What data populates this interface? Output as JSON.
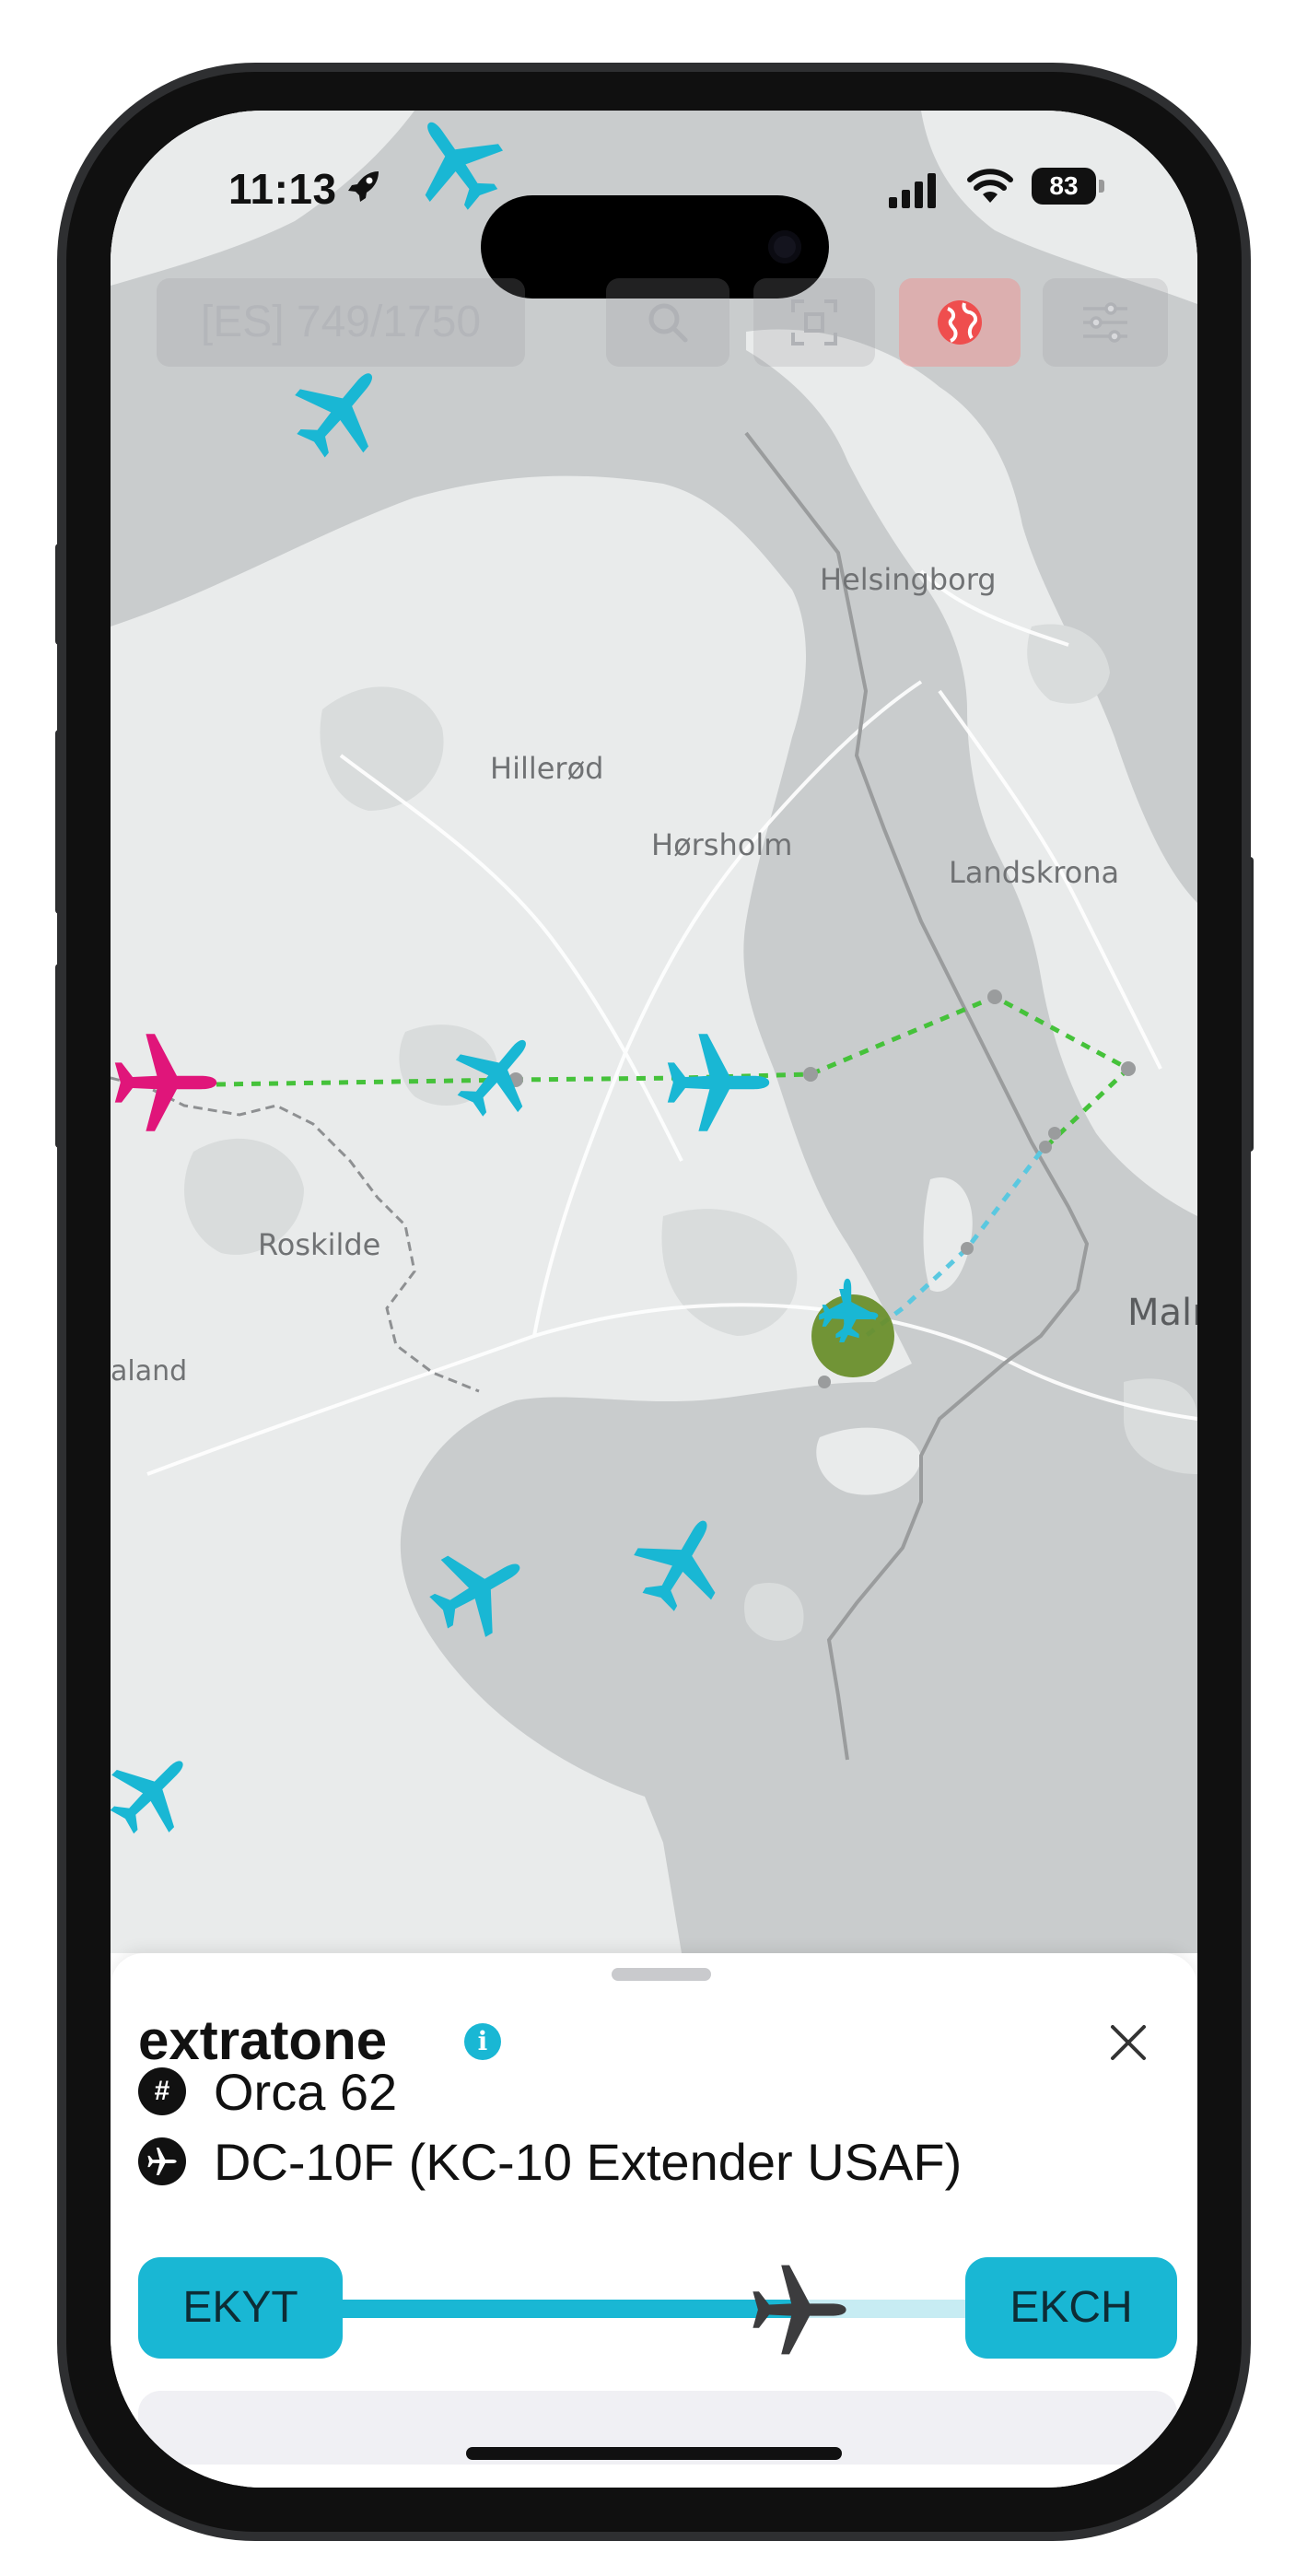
{
  "status_bar": {
    "time": "11:13",
    "battery": "83",
    "rocket_icon": "rocket-icon"
  },
  "toolbar": {
    "count_label": "[ES] 749/1750",
    "search_icon": "search-icon",
    "scan_icon": "scan-icon",
    "globe_icon": "globe-icon",
    "filter_icon": "sliders-icon"
  },
  "map": {
    "cities": [
      "Helsingborg",
      "Hillerød",
      "Hørsholm",
      "Landskrona",
      "Roskilde",
      "Malı",
      "aland"
    ],
    "selected_plane_color": "#e0157a",
    "plane_color": "#19b7d4",
    "route_color": "#45c23a",
    "route_future_color": "#5ac8e0",
    "airport_marker_color": "#6a8f2c"
  },
  "flight": {
    "callsign": "extratone",
    "flight_number": "Orca 62",
    "aircraft": "DC-10F (KC-10 Extender USAF)",
    "origin": "EKYT",
    "destination": "EKCH",
    "progress": 0.71
  }
}
